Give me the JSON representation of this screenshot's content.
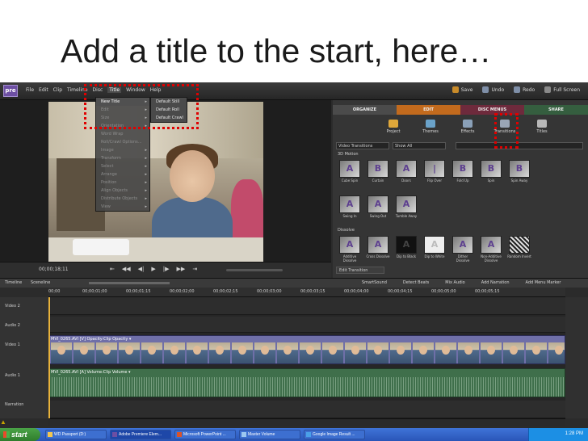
{
  "slide": {
    "title": "Add a title to the start, here…"
  },
  "app": {
    "logo_text": "pre",
    "menu": [
      "File",
      "Edit",
      "Clip",
      "Timeline",
      "Disc",
      "Title",
      "Window",
      "Help"
    ],
    "active_menu": "Title",
    "top_actions": [
      {
        "label": "Save",
        "icon": "save-icon"
      },
      {
        "label": "Undo",
        "icon": "undo-icon"
      },
      {
        "label": "Redo",
        "icon": "redo-icon"
      },
      {
        "label": "Full Screen",
        "icon": "fullscreen-icon"
      }
    ],
    "title_menu": [
      {
        "label": "New Title",
        "has_submenu": true,
        "selected": true
      },
      {
        "label": "Edit",
        "has_submenu": true
      },
      {
        "label": "Size",
        "has_submenu": true
      },
      {
        "label": "Orientation",
        "has_submenu": true
      },
      {
        "label": "Word Wrap"
      },
      {
        "label": "Roll/Crawl Options..."
      },
      {
        "label": "Image",
        "has_submenu": true
      },
      {
        "label": "Transform",
        "has_submenu": true
      },
      {
        "label": "Select",
        "has_submenu": true
      },
      {
        "label": "Arrange",
        "has_submenu": true
      },
      {
        "label": "Position",
        "has_submenu": true
      },
      {
        "label": "Align Objects",
        "has_submenu": true
      },
      {
        "label": "Distribute Objects",
        "has_submenu": true
      },
      {
        "label": "View",
        "has_submenu": true
      }
    ],
    "new_title_submenu": [
      "Default Still",
      "Default Roll",
      "Default Crawl"
    ],
    "monitor": {
      "timecode": "00;00;18;11"
    },
    "panel": {
      "tabs": [
        "ORGANIZE",
        "EDIT",
        "DISC MENUS",
        "SHARE"
      ],
      "active_tab": "EDIT",
      "tools": [
        {
          "label": "Project",
          "icon": "project-icon"
        },
        {
          "label": "Themes",
          "icon": "themes-icon"
        },
        {
          "label": "Effects",
          "icon": "effects-icon"
        },
        {
          "label": "Transitions",
          "icon": "transitions-icon"
        },
        {
          "label": "Titles",
          "icon": "titles-icon"
        }
      ],
      "filter_category": "Video Transitions",
      "filter_show": "Show All",
      "section_3d": "3D Motion",
      "transitions_3d": [
        "Cube Spin",
        "Curtain",
        "Doors",
        "Flip Over",
        "Fold Up",
        "Spin",
        "Spin Away"
      ],
      "transitions_3d_row2": [
        "Swing In",
        "Swing Out",
        "Tumble Away"
      ],
      "section_dissolve": "Dissolve",
      "transitions_dissolve": [
        "Additive Dissolve",
        "Cross Dissolve",
        "Dip to Black",
        "Dip to White",
        "Dither Dissolve",
        "Non-Additive Dissolve",
        "Random Invert"
      ],
      "edit_transition_label": "Edit Transition"
    },
    "timeline": {
      "tabs": [
        "Timeline",
        "Sceneline"
      ],
      "tools": [
        "SmartSound",
        "Detect Beats",
        "Mix Audio",
        "Add Narration",
        "Add Menu Marker"
      ],
      "ruler": [
        "00;00",
        "00;00;01;00",
        "00;00;01;15",
        "00;00;02;00",
        "00;00;02;15",
        "00;00;03;00",
        "00;00;03;15",
        "00;00;04;00",
        "00;00;04;15",
        "00;00;05;00",
        "00;00;05;15"
      ],
      "tracks": [
        "Video 2",
        "Audio 2",
        "Video 1",
        "Audio 1",
        "Narration"
      ],
      "video_clip_label": "MVI_0265.AVI [V] Opacity:Clip Opacity ▾",
      "audio_clip_label": "MVI_0265.AVI [A] Volume:Clip Volume ▾"
    }
  },
  "taskbar": {
    "start_label": "start",
    "tasks": [
      "WD Passport (D:)",
      "Adobe Premiere Elem...",
      "Microsoft PowerPoint ...",
      "Master Volume",
      "Google Image Result ..."
    ],
    "active_task": "Adobe Premiere Elem...",
    "clock": "1:28 PM"
  },
  "colors": {
    "highlight_box": "#e00000",
    "edit_tab": "#c26a1d",
    "disc_tab": "#6e2a3c",
    "share_tab": "#355e3f",
    "video_clip": "#6f6fa8",
    "audio_clip": "#3f6f4b"
  }
}
